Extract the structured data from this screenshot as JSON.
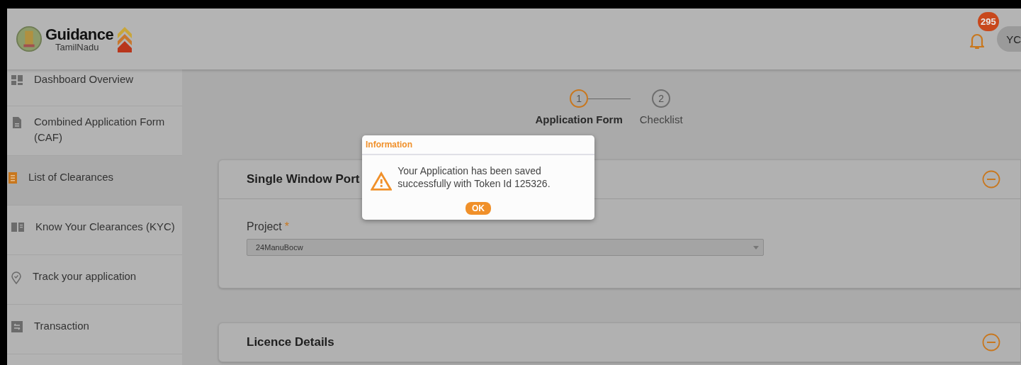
{
  "header": {
    "logo_title": "Guidance",
    "logo_subtitle": "TamilNadu",
    "notification_count": "295",
    "avatar": "YC"
  },
  "sidebar": {
    "items": [
      {
        "label": "Dashboard Overview",
        "selected": false
      },
      {
        "label": "Combined Application Form (CAF)",
        "selected": false
      },
      {
        "label": "List of Clearances",
        "selected": true
      },
      {
        "label": "Know Your Clearances (KYC)",
        "selected": false
      },
      {
        "label": "Track your application",
        "selected": false
      },
      {
        "label": "Transaction",
        "selected": false
      }
    ]
  },
  "stepper": {
    "steps": [
      {
        "number": "1",
        "label": "Application Form",
        "selected": true
      },
      {
        "number": "2",
        "label": "Checklist",
        "selected": false
      }
    ]
  },
  "panels": [
    {
      "title": "Single Window Port",
      "expanded": true,
      "field": {
        "label": "Project",
        "required_mark": "*",
        "value": "24ManuBocw"
      }
    },
    {
      "title": "Licence Details",
      "expanded": true
    }
  ],
  "dialog": {
    "title": "Information",
    "message": "Your Application has been saved successfully with Token Id 125326.",
    "button": "OK"
  }
}
